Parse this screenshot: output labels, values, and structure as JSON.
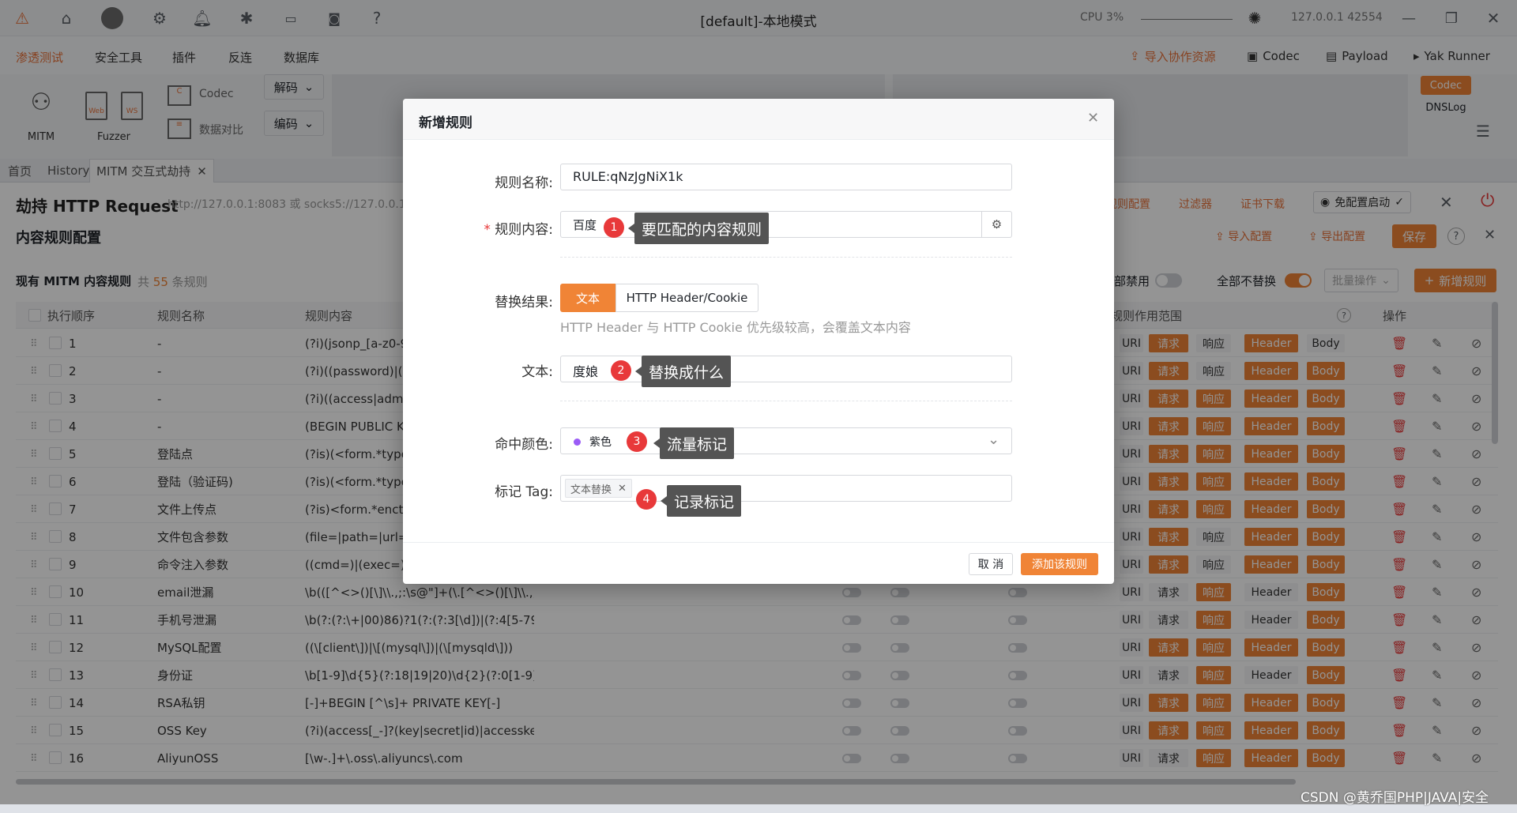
{
  "window": {
    "title": "[default]-本地模式",
    "cpu_label": "CPU 3%",
    "address": "127.0.0.1 42554"
  },
  "menubar": {
    "items": [
      "渗透测试",
      "安全工具",
      "插件",
      "反连",
      "数据库"
    ],
    "right": [
      "导入协作资源",
      "Codec",
      "Payload",
      "Yak Runner"
    ]
  },
  "ribbon": {
    "mitm": "MITM",
    "fuzzer": "Fuzzer",
    "web": "Web",
    "ws": "WS",
    "codec": "Codec",
    "compare": "数据对比",
    "decode": "解码",
    "encode": "编码",
    "side_codec": "Codec",
    "side_dnslog": "DNSLog"
  },
  "tabs": [
    "首页",
    "History",
    "MITM 交互式劫持"
  ],
  "hijack": {
    "title": "劫持 HTTP Request",
    "proxy": "http://127.0.0.1:8083 或 socks5://127.0.0.1:80",
    "rule_config": "规则配置",
    "filter": "过滤器",
    "cert": "证书下载",
    "browser": "免配置启动"
  },
  "content_rules": {
    "title": "内容规则配置",
    "import": "导入配置",
    "export": "导出配置",
    "save": "保存"
  },
  "list": {
    "title": "现有 MITM 内容规则",
    "count_prefix": "共",
    "count": "55",
    "count_suffix": "条规则",
    "disable_all": "部禁用",
    "no_replace_all": "全部不替换",
    "batch": "批量操作",
    "add": "新增规则"
  },
  "table": {
    "headers": [
      "执行顺序",
      "规则名称",
      "规则内容",
      "规则作用范围",
      "操作"
    ],
    "scope_labels": [
      "URI",
      "请求",
      "响应",
      "Header",
      "Body"
    ],
    "rows": [
      {
        "n": "1",
        "name": "-",
        "content": "(?i)(jsonp_[a-z0-9]+",
        "scope": [
          false,
          true,
          false,
          true,
          false
        ]
      },
      {
        "n": "2",
        "name": "-",
        "content": "(?i)((password)|(pas",
        "scope": [
          false,
          true,
          false,
          true,
          true
        ]
      },
      {
        "n": "3",
        "name": "-",
        "content": "(?i)((access|admin|a",
        "scope": [
          false,
          true,
          true,
          true,
          true
        ]
      },
      {
        "n": "4",
        "name": "-",
        "content": "(BEGIN PUBLIC KEY",
        "scope": [
          false,
          true,
          true,
          true,
          true
        ]
      },
      {
        "n": "5",
        "name": "登陆点",
        "content": "(?is)(<form.*type=.",
        "scope": [
          false,
          true,
          true,
          true,
          true
        ]
      },
      {
        "n": "6",
        "name": "登陆（验证码)",
        "content": "(?is)(<form.*type=.",
        "scope": [
          false,
          true,
          true,
          true,
          true
        ]
      },
      {
        "n": "7",
        "name": "文件上传点",
        "content": "(?is)<form.*enctyp",
        "scope": [
          false,
          true,
          true,
          true,
          true
        ]
      },
      {
        "n": "8",
        "name": "文件包含参数",
        "content": "(file=|path=|url=|la",
        "scope": [
          false,
          true,
          false,
          true,
          true
        ]
      },
      {
        "n": "9",
        "name": "命令注入参数",
        "content": "((cmd=)|(exec=)|(cc",
        "scope": [
          false,
          true,
          false,
          true,
          true
        ]
      },
      {
        "n": "10",
        "name": "email泄漏",
        "content": "\\b(([^<>()[\\]\\\\.,;:\\s@\"]+(\\.[^<>()[\\]\\\\.,;:\\s...",
        "scope": [
          false,
          false,
          true,
          false,
          true
        ]
      },
      {
        "n": "11",
        "name": "手机号泄漏",
        "content": "\\b(?:(?:\\+|00)86)?1(?:(?:3[\\d])|(?:4[5-79])...",
        "scope": [
          false,
          false,
          true,
          false,
          true
        ]
      },
      {
        "n": "12",
        "name": "MySQL配置",
        "content": "((\\[client\\])|\\[(mysql\\])|(\\[mysqld\\]))",
        "scope": [
          false,
          true,
          true,
          true,
          true
        ]
      },
      {
        "n": "13",
        "name": "身份证",
        "content": "\\b[1-9]\\d{5}(?:18|19|20)\\d{2}(?:0[1-9]|10...",
        "scope": [
          false,
          false,
          true,
          false,
          true
        ]
      },
      {
        "n": "14",
        "name": "RSA私钥",
        "content": "[-]+BEGIN [^\\s]+ PRIVATE KEY[-]",
        "scope": [
          false,
          true,
          true,
          true,
          true
        ]
      },
      {
        "n": "15",
        "name": "OSS Key",
        "content": "(?i)(access[_-]?(key|secret|id)|accesskey(...",
        "scope": [
          false,
          true,
          true,
          true,
          true
        ]
      },
      {
        "n": "16",
        "name": "AliyunOSS",
        "content": "[\\w-.]+\\.oss\\.aliyuncs\\.com",
        "scope": [
          false,
          false,
          true,
          true,
          true
        ]
      }
    ]
  },
  "modal": {
    "title": "新增规则",
    "name_label": "规则名称:",
    "name_value": "RULE:qNzJgNiX1k",
    "content_label": "规则内容:",
    "content_value": "百度",
    "result_label": "替换结果:",
    "seg_text": "文本",
    "seg_header": "HTTP Header/Cookie",
    "hint": "HTTP Header 与 HTTP Cookie 优先级较高，会覆盖文本内容",
    "text_label": "文本:",
    "text_value": "度娘",
    "color_label": "命中颜色:",
    "color_value": "紫色",
    "color_dot": "#9b5cf6",
    "tag_label": "标记 Tag:",
    "tag_value": "文本替换",
    "cancel": "取 消",
    "submit": "添加该规则"
  },
  "callouts": [
    {
      "num": "1",
      "text": "要匹配的内容规则"
    },
    {
      "num": "2",
      "text": "替换成什么"
    },
    {
      "num": "3",
      "text": "流量标记"
    },
    {
      "num": "4",
      "text": "记录标记"
    }
  ],
  "watermark": "CSDN @黄乔国PHP|JAVA|安全",
  "colors": {
    "accent": "#f08436",
    "danger": "#e8393a"
  }
}
